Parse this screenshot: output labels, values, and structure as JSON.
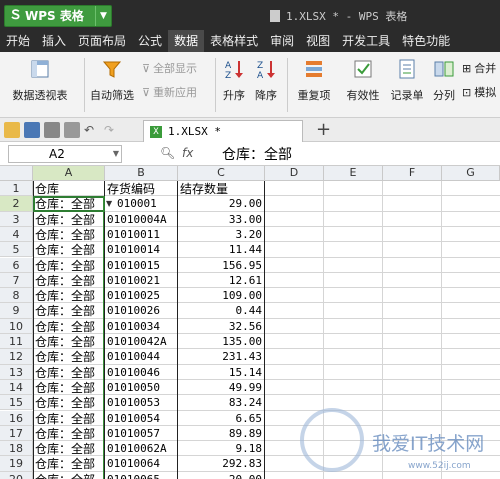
{
  "app": {
    "logo_text": "WPS 表格",
    "window_title": "1.XLSX * - WPS 表格"
  },
  "menu": [
    "开始",
    "插入",
    "页面布局",
    "公式",
    "数据",
    "表格样式",
    "审阅",
    "视图",
    "开发工具",
    "特色功能"
  ],
  "menu_active": "数据",
  "ribbon": {
    "pivot": "数据透视表",
    "autofilter": "自动筛选",
    "show_all": "全部显示",
    "reapply": "重新应用",
    "asc": "升序",
    "desc": "降序",
    "duplicates": "重复项",
    "validity": "有效性",
    "record": "记录单",
    "split": "分列",
    "merge": "合并",
    "simulate": "模拟"
  },
  "doc_tab": "1.XLSX *",
  "formula_bar": {
    "cell_ref": "A2",
    "fx": "fx",
    "value": "仓库：全部"
  },
  "columns": [
    "A",
    "B",
    "C",
    "D",
    "E",
    "F",
    "G"
  ],
  "headers": [
    "仓库",
    "存货编码",
    "结存数量"
  ],
  "rows": [
    {
      "n": "1",
      "a": "仓库",
      "b": "存货编码",
      "c": "结存数量"
    },
    {
      "n": "2",
      "a": "仓库：全部",
      "b": "010001",
      "c": "29.00"
    },
    {
      "n": "3",
      "a": "仓库：全部",
      "b": "01010004A",
      "c": "33.00"
    },
    {
      "n": "4",
      "a": "仓库：全部",
      "b": "01010011",
      "c": "3.20"
    },
    {
      "n": "5",
      "a": "仓库：全部",
      "b": "01010014",
      "c": "11.44"
    },
    {
      "n": "6",
      "a": "仓库：全部",
      "b": "01010015",
      "c": "156.95"
    },
    {
      "n": "7",
      "a": "仓库：全部",
      "b": "01010021",
      "c": "12.61"
    },
    {
      "n": "8",
      "a": "仓库：全部",
      "b": "01010025",
      "c": "109.00"
    },
    {
      "n": "9",
      "a": "仓库：全部",
      "b": "01010026",
      "c": "0.44"
    },
    {
      "n": "10",
      "a": "仓库：全部",
      "b": "01010034",
      "c": "32.56"
    },
    {
      "n": "11",
      "a": "仓库：全部",
      "b": "01010042A",
      "c": "135.00"
    },
    {
      "n": "12",
      "a": "仓库：全部",
      "b": "01010044",
      "c": "231.43"
    },
    {
      "n": "13",
      "a": "仓库：全部",
      "b": "01010046",
      "c": "15.14"
    },
    {
      "n": "14",
      "a": "仓库：全部",
      "b": "01010050",
      "c": "49.99"
    },
    {
      "n": "15",
      "a": "仓库：全部",
      "b": "01010053",
      "c": "83.24"
    },
    {
      "n": "16",
      "a": "仓库：全部",
      "b": "01010054",
      "c": "6.65"
    },
    {
      "n": "17",
      "a": "仓库：全部",
      "b": "01010057",
      "c": "89.89"
    },
    {
      "n": "18",
      "a": "仓库：全部",
      "b": "01010062A",
      "c": "9.18"
    },
    {
      "n": "19",
      "a": "仓库：全部",
      "b": "01010064",
      "c": "292.83"
    },
    {
      "n": "20",
      "a": "仓库：全部",
      "b": "01010065",
      "c": "20.00"
    }
  ],
  "watermark": {
    "text": "我爱IT技术网",
    "url": "www.52ij.com"
  },
  "colors": {
    "title_bg": "#2b2b2b",
    "logo_green": "#3f9b3f",
    "selected_header": "#d8e8c4",
    "ribbon_bg": "#f3f3f3"
  }
}
